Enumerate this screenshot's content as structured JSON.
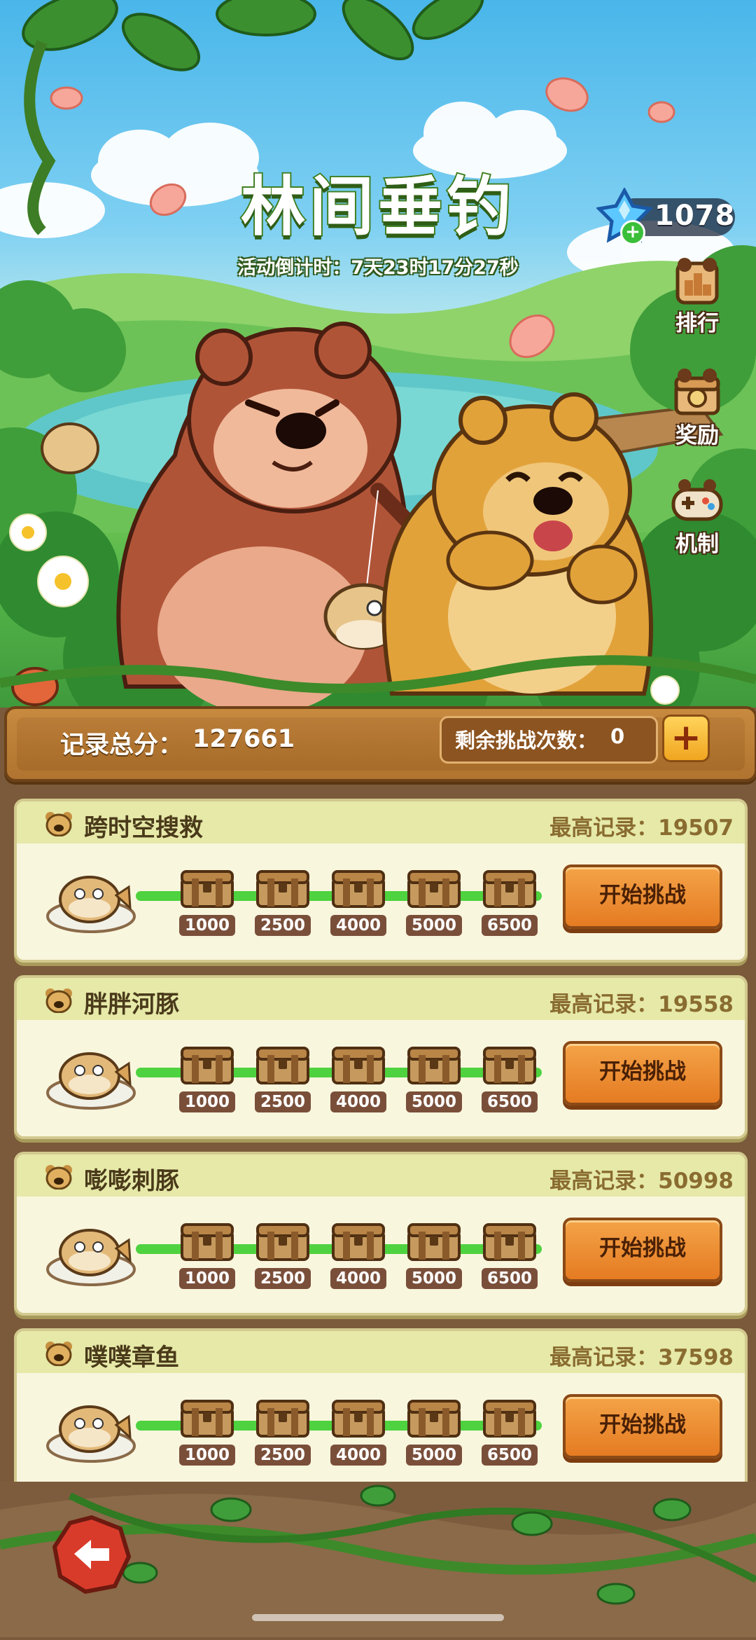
{
  "header": {
    "title": "林间垂钓",
    "countdown": "活动倒计时：7天23时17分27秒"
  },
  "currency": {
    "count": "1078",
    "icon": "blue-crystal-icon"
  },
  "side_menu": [
    {
      "label": "排行",
      "icon": "ranking-icon"
    },
    {
      "label": "奖励",
      "icon": "reward-icon"
    },
    {
      "label": "机制",
      "icon": "gamepad-icon"
    }
  ],
  "score": {
    "total_label": "记录总分：",
    "total_value": "127661",
    "attempts_label": "剩余挑战次数：",
    "attempts_value": "0",
    "add_label": "+"
  },
  "levels": [
    {
      "title": "跨时空搜救",
      "best_label": "最高记录：",
      "best": "19507",
      "milestones": [
        "1000",
        "2500",
        "4000",
        "5000",
        "6500"
      ],
      "button": "开始挑战",
      "fish": "pufferfish"
    },
    {
      "title": "胖胖河豚",
      "best_label": "最高记录：",
      "best": "19558",
      "milestones": [
        "1000",
        "2500",
        "4000",
        "5000",
        "6500"
      ],
      "button": "开始挑战",
      "fish": "pufferfish-pair"
    },
    {
      "title": "嘭嘭刺豚",
      "best_label": "最高记录：",
      "best": "50998",
      "milestones": [
        "1000",
        "2500",
        "4000",
        "5000",
        "6500"
      ],
      "button": "开始挑战",
      "fish": "porcupinefish-group"
    },
    {
      "title": "噗噗章鱼",
      "best_label": "最高记录：",
      "best": "37598",
      "milestones": [
        "1000",
        "2500",
        "4000",
        "5000",
        "6500"
      ],
      "button": "开始挑战",
      "fish": "octopus-group"
    }
  ],
  "colors": {
    "progress": "#4fd23f",
    "button": "#e57b22",
    "card": "#f7f2d0",
    "wood": "#b07430"
  }
}
